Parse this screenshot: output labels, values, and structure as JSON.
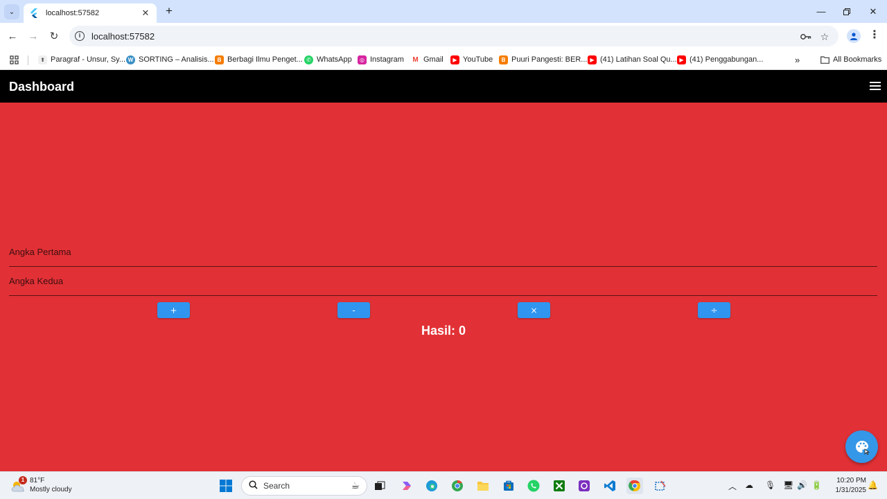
{
  "browser": {
    "tab_title": "localhost:57582",
    "url": "localhost:57582",
    "bookmarks": [
      {
        "label": "Paragraf - Unsur, Sy...",
        "icon": "generic-icon",
        "color": "#f0f0f0"
      },
      {
        "label": "SORTING – Analisis...",
        "icon": "wordpress-icon",
        "color": "#3a8fc6"
      },
      {
        "label": "Berbagi Ilmu Penget...",
        "icon": "blogger-icon",
        "color": "#f57d00"
      },
      {
        "label": "WhatsApp",
        "icon": "whatsapp-icon",
        "color": "#25d366"
      },
      {
        "label": "Instagram",
        "icon": "instagram-icon",
        "color": "#d6249f"
      },
      {
        "label": "Gmail",
        "icon": "gmail-icon",
        "color": "#ea4335"
      },
      {
        "label": "YouTube",
        "icon": "youtube-icon",
        "color": "#ff0000"
      },
      {
        "label": "Puuri Pangesti: BER...",
        "icon": "blogger-icon",
        "color": "#f57d00"
      },
      {
        "label": "(41) Latihan Soal Qu...",
        "icon": "youtube-icon",
        "color": "#ff0000"
      },
      {
        "label": "(41) Penggabungan...",
        "icon": "youtube-icon",
        "color": "#ff0000"
      }
    ],
    "overflow_label": "»",
    "all_bookmarks": "All Bookmarks"
  },
  "app": {
    "title": "Dashboard",
    "background": "#e23136",
    "field1_placeholder": "Angka Pertama",
    "field2_placeholder": "Angka Kedua",
    "buttons": {
      "add": "+",
      "subtract": "-",
      "multiply": "×",
      "divide": "÷"
    },
    "result_text": "Hasil: 0"
  },
  "taskbar": {
    "weather_temp": "81°F",
    "weather_condition": "Mostly cloudy",
    "weather_badge": "1",
    "search_label": "Search",
    "time": "10:20 PM",
    "date": "1/31/2025"
  }
}
